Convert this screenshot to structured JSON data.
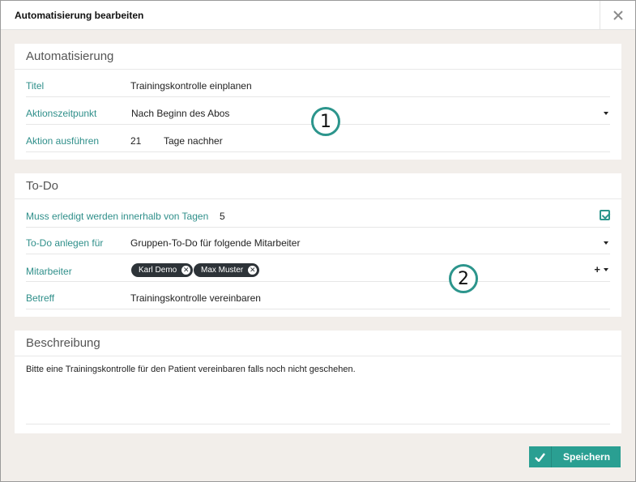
{
  "dialog": {
    "title": "Automatisierung bearbeiten",
    "close_symbol": "✕"
  },
  "automation": {
    "heading": "Automatisierung",
    "title_label": "Titel",
    "title_value": "Trainingskontrolle einplanen",
    "time_label": "Aktionszeitpunkt",
    "time_value": "Nach Beginn des Abos",
    "run_label": "Aktion ausführen",
    "run_days": "21",
    "run_unit": "Tage nachher"
  },
  "todo": {
    "heading": "To-Do",
    "deadline_label": "Muss erledigt werden innerhalb von Tagen",
    "deadline_value": "5",
    "deadline_checked": true,
    "create_for_label": "To-Do anlegen für",
    "create_for_value": "Gruppen-To-Do für folgende Mitarbeiter",
    "staff_label": "Mitarbeiter",
    "staff": [
      "Karl Demo",
      "Max Muster"
    ],
    "add_symbol": "+",
    "subject_label": "Betreff",
    "subject_value": "Trainingskontrolle vereinbaren"
  },
  "description": {
    "heading": "Beschreibung",
    "text": "Bitte eine Trainingskontrolle für den Patient vereinbaren falls noch nicht geschehen."
  },
  "annotations": [
    "1",
    "2"
  ],
  "footer": {
    "save_label": "Speichern"
  },
  "colors": {
    "accent": "#2c958c",
    "button": "#2a9f92",
    "chip": "#2d3338",
    "label": "#2f8f8a"
  },
  "icons": {
    "close": "close-icon",
    "check": "check-icon",
    "remove": "remove-chip-icon",
    "add": "plus-icon",
    "dropdown": "caret-down-icon"
  }
}
